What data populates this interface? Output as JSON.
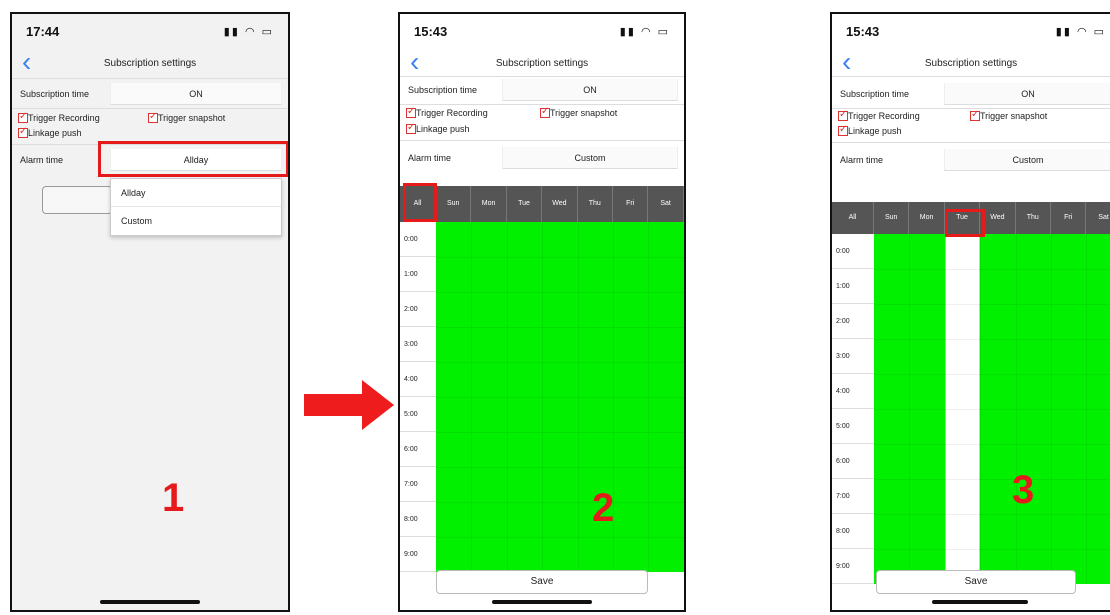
{
  "colors": {
    "accent": "#3b82f6",
    "highlight": "#e51b1b",
    "enabled": "#00f000",
    "header": "#555555"
  },
  "screens": [
    {
      "time": "17:44",
      "title": "Subscription settings",
      "subscription_label": "Subscription time",
      "subscription_value": "ON",
      "trigger_recording": "Trigger Recording",
      "trigger_snapshot": "Trigger snapshot",
      "linkage_push": "Linkage push",
      "alarm_label": "Alarm time",
      "alarm_value": "Allday",
      "dropdown_options": [
        "Allday",
        "Custom"
      ],
      "step": "1"
    },
    {
      "time": "15:43",
      "title": "Subscription settings",
      "subscription_label": "Subscription time",
      "subscription_value": "ON",
      "trigger_recording": "Trigger Recording",
      "trigger_snapshot": "Trigger snapshot",
      "linkage_push": "Linkage push",
      "alarm_label": "Alarm time",
      "alarm_value": "Custom",
      "step": "2",
      "save": "Save"
    },
    {
      "time": "15:43",
      "title": "Subscription settings",
      "subscription_label": "Subscription time",
      "subscription_value": "ON",
      "trigger_recording": "Trigger Recording",
      "trigger_snapshot": "Trigger snapshot",
      "linkage_push": "Linkage push",
      "alarm_label": "Alarm time",
      "alarm_value": "Custom",
      "step": "3",
      "save": "Save"
    }
  ],
  "schedule": {
    "all_label": "All",
    "days": [
      "Sun",
      "Mon",
      "Tue",
      "Wed",
      "Thu",
      "Fri",
      "Sat"
    ],
    "hours": [
      "0:00",
      "1:00",
      "2:00",
      "3:00",
      "4:00",
      "5:00",
      "6:00",
      "7:00",
      "8:00",
      "9:00"
    ]
  }
}
